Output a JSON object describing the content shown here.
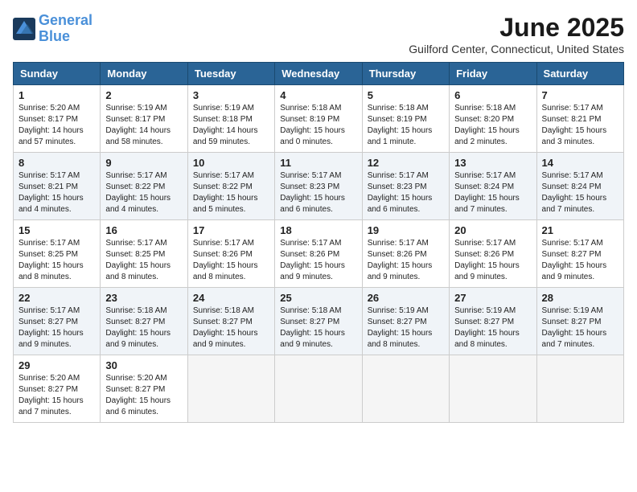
{
  "logo": {
    "line1": "General",
    "line2": "Blue"
  },
  "title": "June 2025",
  "location": "Guilford Center, Connecticut, United States",
  "weekdays": [
    "Sunday",
    "Monday",
    "Tuesday",
    "Wednesday",
    "Thursday",
    "Friday",
    "Saturday"
  ],
  "weeks": [
    [
      {
        "day": "1",
        "info": "Sunrise: 5:20 AM\nSunset: 8:17 PM\nDaylight: 14 hours\nand 57 minutes."
      },
      {
        "day": "2",
        "info": "Sunrise: 5:19 AM\nSunset: 8:17 PM\nDaylight: 14 hours\nand 58 minutes."
      },
      {
        "day": "3",
        "info": "Sunrise: 5:19 AM\nSunset: 8:18 PM\nDaylight: 14 hours\nand 59 minutes."
      },
      {
        "day": "4",
        "info": "Sunrise: 5:18 AM\nSunset: 8:19 PM\nDaylight: 15 hours\nand 0 minutes."
      },
      {
        "day": "5",
        "info": "Sunrise: 5:18 AM\nSunset: 8:19 PM\nDaylight: 15 hours\nand 1 minute."
      },
      {
        "day": "6",
        "info": "Sunrise: 5:18 AM\nSunset: 8:20 PM\nDaylight: 15 hours\nand 2 minutes."
      },
      {
        "day": "7",
        "info": "Sunrise: 5:17 AM\nSunset: 8:21 PM\nDaylight: 15 hours\nand 3 minutes."
      }
    ],
    [
      {
        "day": "8",
        "info": "Sunrise: 5:17 AM\nSunset: 8:21 PM\nDaylight: 15 hours\nand 4 minutes."
      },
      {
        "day": "9",
        "info": "Sunrise: 5:17 AM\nSunset: 8:22 PM\nDaylight: 15 hours\nand 4 minutes."
      },
      {
        "day": "10",
        "info": "Sunrise: 5:17 AM\nSunset: 8:22 PM\nDaylight: 15 hours\nand 5 minutes."
      },
      {
        "day": "11",
        "info": "Sunrise: 5:17 AM\nSunset: 8:23 PM\nDaylight: 15 hours\nand 6 minutes."
      },
      {
        "day": "12",
        "info": "Sunrise: 5:17 AM\nSunset: 8:23 PM\nDaylight: 15 hours\nand 6 minutes."
      },
      {
        "day": "13",
        "info": "Sunrise: 5:17 AM\nSunset: 8:24 PM\nDaylight: 15 hours\nand 7 minutes."
      },
      {
        "day": "14",
        "info": "Sunrise: 5:17 AM\nSunset: 8:24 PM\nDaylight: 15 hours\nand 7 minutes."
      }
    ],
    [
      {
        "day": "15",
        "info": "Sunrise: 5:17 AM\nSunset: 8:25 PM\nDaylight: 15 hours\nand 8 minutes."
      },
      {
        "day": "16",
        "info": "Sunrise: 5:17 AM\nSunset: 8:25 PM\nDaylight: 15 hours\nand 8 minutes."
      },
      {
        "day": "17",
        "info": "Sunrise: 5:17 AM\nSunset: 8:26 PM\nDaylight: 15 hours\nand 8 minutes."
      },
      {
        "day": "18",
        "info": "Sunrise: 5:17 AM\nSunset: 8:26 PM\nDaylight: 15 hours\nand 9 minutes."
      },
      {
        "day": "19",
        "info": "Sunrise: 5:17 AM\nSunset: 8:26 PM\nDaylight: 15 hours\nand 9 minutes."
      },
      {
        "day": "20",
        "info": "Sunrise: 5:17 AM\nSunset: 8:26 PM\nDaylight: 15 hours\nand 9 minutes."
      },
      {
        "day": "21",
        "info": "Sunrise: 5:17 AM\nSunset: 8:27 PM\nDaylight: 15 hours\nand 9 minutes."
      }
    ],
    [
      {
        "day": "22",
        "info": "Sunrise: 5:17 AM\nSunset: 8:27 PM\nDaylight: 15 hours\nand 9 minutes."
      },
      {
        "day": "23",
        "info": "Sunrise: 5:18 AM\nSunset: 8:27 PM\nDaylight: 15 hours\nand 9 minutes."
      },
      {
        "day": "24",
        "info": "Sunrise: 5:18 AM\nSunset: 8:27 PM\nDaylight: 15 hours\nand 9 minutes."
      },
      {
        "day": "25",
        "info": "Sunrise: 5:18 AM\nSunset: 8:27 PM\nDaylight: 15 hours\nand 9 minutes."
      },
      {
        "day": "26",
        "info": "Sunrise: 5:19 AM\nSunset: 8:27 PM\nDaylight: 15 hours\nand 8 minutes."
      },
      {
        "day": "27",
        "info": "Sunrise: 5:19 AM\nSunset: 8:27 PM\nDaylight: 15 hours\nand 8 minutes."
      },
      {
        "day": "28",
        "info": "Sunrise: 5:19 AM\nSunset: 8:27 PM\nDaylight: 15 hours\nand 7 minutes."
      }
    ],
    [
      {
        "day": "29",
        "info": "Sunrise: 5:20 AM\nSunset: 8:27 PM\nDaylight: 15 hours\nand 7 minutes."
      },
      {
        "day": "30",
        "info": "Sunrise: 5:20 AM\nSunset: 8:27 PM\nDaylight: 15 hours\nand 6 minutes."
      },
      {
        "day": "",
        "info": ""
      },
      {
        "day": "",
        "info": ""
      },
      {
        "day": "",
        "info": ""
      },
      {
        "day": "",
        "info": ""
      },
      {
        "day": "",
        "info": ""
      }
    ]
  ]
}
